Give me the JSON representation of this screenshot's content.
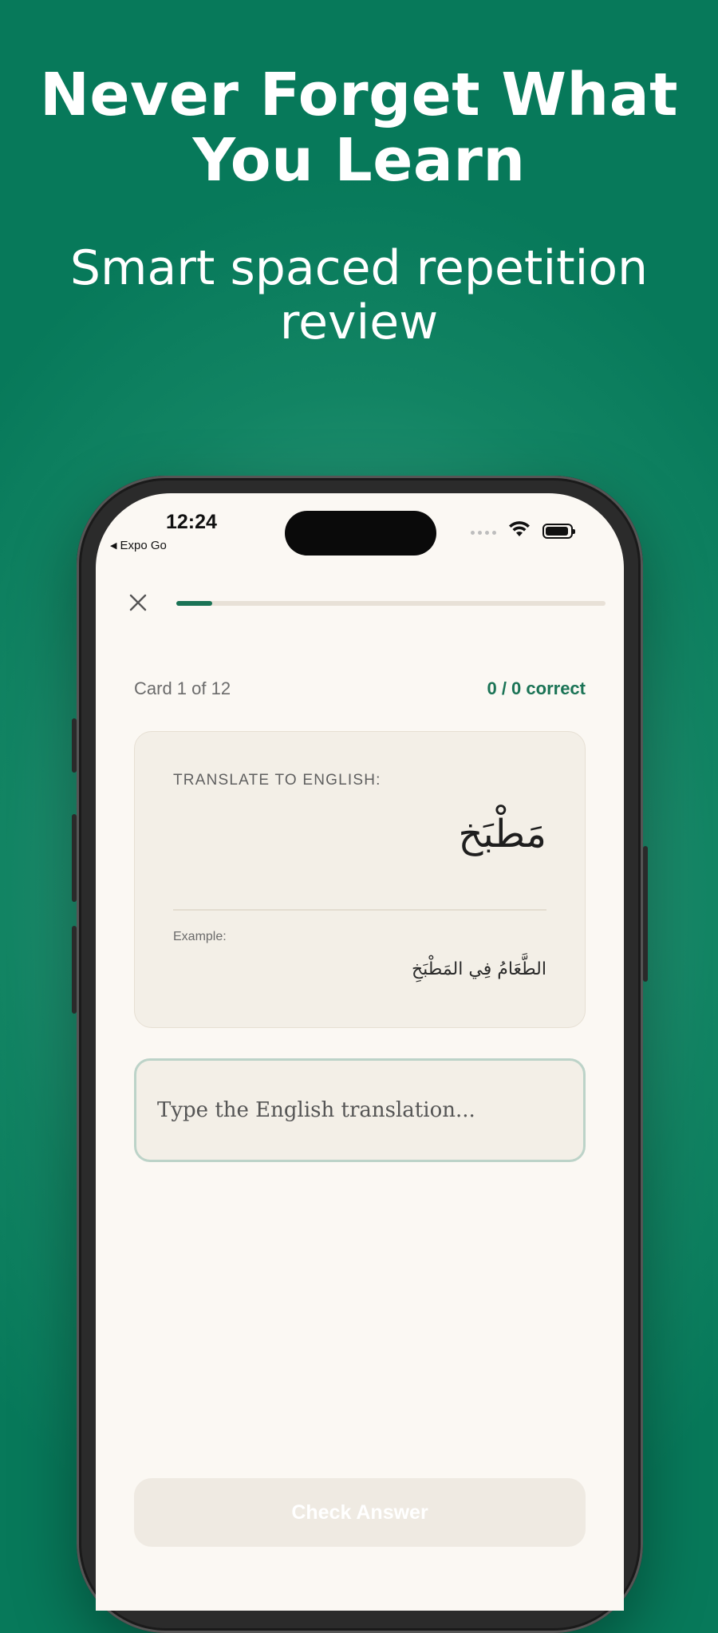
{
  "hero": {
    "title_line1": "Never Forget What",
    "title_line2": "You Learn",
    "subtitle_line1": "Smart spaced repetition",
    "subtitle_line2": "review"
  },
  "status_bar": {
    "time": "12:24",
    "back_app": "Expo Go"
  },
  "session": {
    "progress_fraction": 0.083,
    "card_counter": "Card 1 of 12",
    "score": "0 / 0 correct"
  },
  "card": {
    "instruction": "TRANSLATE TO ENGLISH:",
    "word": "مَطْبَخ",
    "example_label": "Example:",
    "example_sentence": "الطَّعَامُ فِي المَطْبَخِ"
  },
  "answer": {
    "placeholder": "Type the English translation...",
    "value": ""
  },
  "actions": {
    "check_label": "Check Answer"
  },
  "colors": {
    "brand_green": "#1a7355",
    "background_green": "#07795a",
    "screen_bg": "#fbf8f3",
    "card_bg": "#f3efe7"
  }
}
